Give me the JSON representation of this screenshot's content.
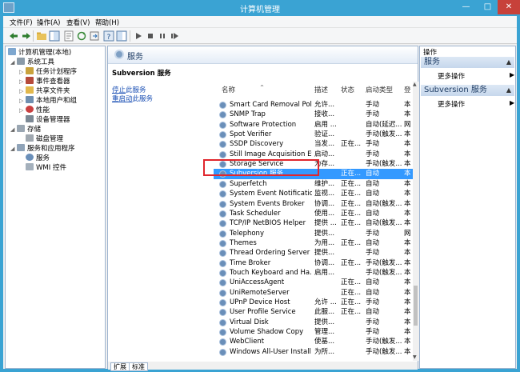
{
  "window": {
    "title": "计算机管理",
    "min": "—",
    "max": "□",
    "close": "✕"
  },
  "menu": [
    "文件(F)",
    "操作(A)",
    "查看(V)",
    "帮助(H)"
  ],
  "tree": {
    "root": "计算机管理(本地)",
    "system_tools": "系统工具",
    "task_scheduler": "任务计划程序",
    "event_viewer": "事件查看器",
    "shared_folders": "共享文件夹",
    "local_users": "本地用户和组",
    "performance": "性能",
    "device_manager": "设备管理器",
    "storage": "存储",
    "disk_management": "磁盘管理",
    "services_apps": "服务和应用程序",
    "services": "服务",
    "wmi": "WMI 控件"
  },
  "center": {
    "header": "服务",
    "desc_title": "Subversion 服务",
    "stop_link": "停止",
    "stop_rest": "此服务",
    "restart_link": "重启动",
    "restart_rest": "此服务",
    "columns": [
      "名称",
      "描述",
      "状态",
      "启动类型",
      "登"
    ]
  },
  "services": [
    {
      "name": "Smart Card Removal Poli...",
      "desc": "允许...",
      "status": "",
      "startup": "手动",
      "logon": "本"
    },
    {
      "name": "SNMP Trap",
      "desc": "接收...",
      "status": "",
      "startup": "手动",
      "logon": "本"
    },
    {
      "name": "Software Protection",
      "desc": "启用 ...",
      "status": "",
      "startup": "自动(延迟...",
      "logon": "网"
    },
    {
      "name": "Spot Verifier",
      "desc": "验证...",
      "status": "",
      "startup": "手动(触发...",
      "logon": "本"
    },
    {
      "name": "SSDP Discovery",
      "desc": "当发...",
      "status": "正在...",
      "startup": "手动",
      "logon": "本"
    },
    {
      "name": "Still Image Acquisition Ev...",
      "desc": "启动...",
      "status": "",
      "startup": "手动",
      "logon": "本"
    },
    {
      "name": "Storage Service",
      "desc": "为存...",
      "status": "",
      "startup": "手动(触发...",
      "logon": "本"
    },
    {
      "name": "Subversion 服务",
      "desc": "",
      "status": "正在...",
      "startup": "自动",
      "logon": "本",
      "selected": true
    },
    {
      "name": "Superfetch",
      "desc": "维护...",
      "status": "正在...",
      "startup": "自动",
      "logon": "本"
    },
    {
      "name": "System Event Notification...",
      "desc": "监视...",
      "status": "正在...",
      "startup": "自动",
      "logon": "本"
    },
    {
      "name": "System Events Broker",
      "desc": "协调...",
      "status": "正在...",
      "startup": "自动(触发...",
      "logon": "本"
    },
    {
      "name": "Task Scheduler",
      "desc": "使用...",
      "status": "正在...",
      "startup": "自动",
      "logon": "本"
    },
    {
      "name": "TCP/IP NetBIOS Helper",
      "desc": "提供 ...",
      "status": "正在...",
      "startup": "自动(触发...",
      "logon": "本"
    },
    {
      "name": "Telephony",
      "desc": "提供...",
      "status": "",
      "startup": "手动",
      "logon": "网"
    },
    {
      "name": "Themes",
      "desc": "为用...",
      "status": "正在...",
      "startup": "自动",
      "logon": "本"
    },
    {
      "name": "Thread Ordering Server",
      "desc": "提供...",
      "status": "",
      "startup": "手动",
      "logon": "本"
    },
    {
      "name": "Time Broker",
      "desc": "协调...",
      "status": "正在...",
      "startup": "手动(触发...",
      "logon": "本"
    },
    {
      "name": "Touch Keyboard and Ha...",
      "desc": "启用...",
      "status": "",
      "startup": "手动(触发...",
      "logon": "本"
    },
    {
      "name": "UniAccessAgent",
      "desc": "",
      "status": "正在...",
      "startup": "自动",
      "logon": "本"
    },
    {
      "name": "UniRemoteServer",
      "desc": "",
      "status": "正在...",
      "startup": "自动",
      "logon": "本"
    },
    {
      "name": "UPnP Device Host",
      "desc": "允许 ...",
      "status": "正在...",
      "startup": "手动",
      "logon": "本"
    },
    {
      "name": "User Profile Service",
      "desc": "此服...",
      "status": "正在...",
      "startup": "自动",
      "logon": "本"
    },
    {
      "name": "Virtual Disk",
      "desc": "提供...",
      "status": "",
      "startup": "手动",
      "logon": "本"
    },
    {
      "name": "Volume Shadow Copy",
      "desc": "管理...",
      "status": "",
      "startup": "手动",
      "logon": "本"
    },
    {
      "name": "WebClient",
      "desc": "使基...",
      "status": "",
      "startup": "手动(触发...",
      "logon": "本"
    },
    {
      "name": "Windows All-User Install ...",
      "desc": "为所...",
      "status": "",
      "startup": "手动(触发...",
      "logon": "本"
    }
  ],
  "bottom_tabs": [
    "扩展",
    "标准"
  ],
  "actions": {
    "title": "操作",
    "section1": "服务",
    "more1": "更多操作",
    "section2": "Subversion 服务",
    "more2": "更多操作"
  },
  "colors": {
    "titlebar": "#3aa3d3",
    "selection": "#3399ff",
    "highlight_box": "#e0262d",
    "close": "#c7413a"
  }
}
